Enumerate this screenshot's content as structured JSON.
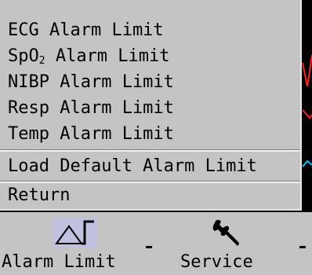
{
  "menu": {
    "items": [
      {
        "label_main": "ECG Alarm Limit",
        "label_sub": ""
      },
      {
        "label_main": "SpO",
        "label_sub": "2",
        "label_rest": " Alarm Limit"
      },
      {
        "label_main": "NIBP Alarm Limit"
      },
      {
        "label_main": "Resp Alarm Limit"
      },
      {
        "label_main": "Temp Alarm Limit"
      },
      {
        "label_main": "Load Default Alarm Limit"
      },
      {
        "label_main": "Return"
      }
    ]
  },
  "toolbar": {
    "alarm_limit": {
      "label": "Alarm Limit",
      "icon": "alarm-limit-icon"
    },
    "service": {
      "label": "Service",
      "icon": "wrench-icon"
    }
  },
  "colors": {
    "panel": "#c4c4c4",
    "background": "#000000",
    "trace_green": "#00c000",
    "trace_red": "#ff2020",
    "trace_cyan": "#00c8ff"
  }
}
